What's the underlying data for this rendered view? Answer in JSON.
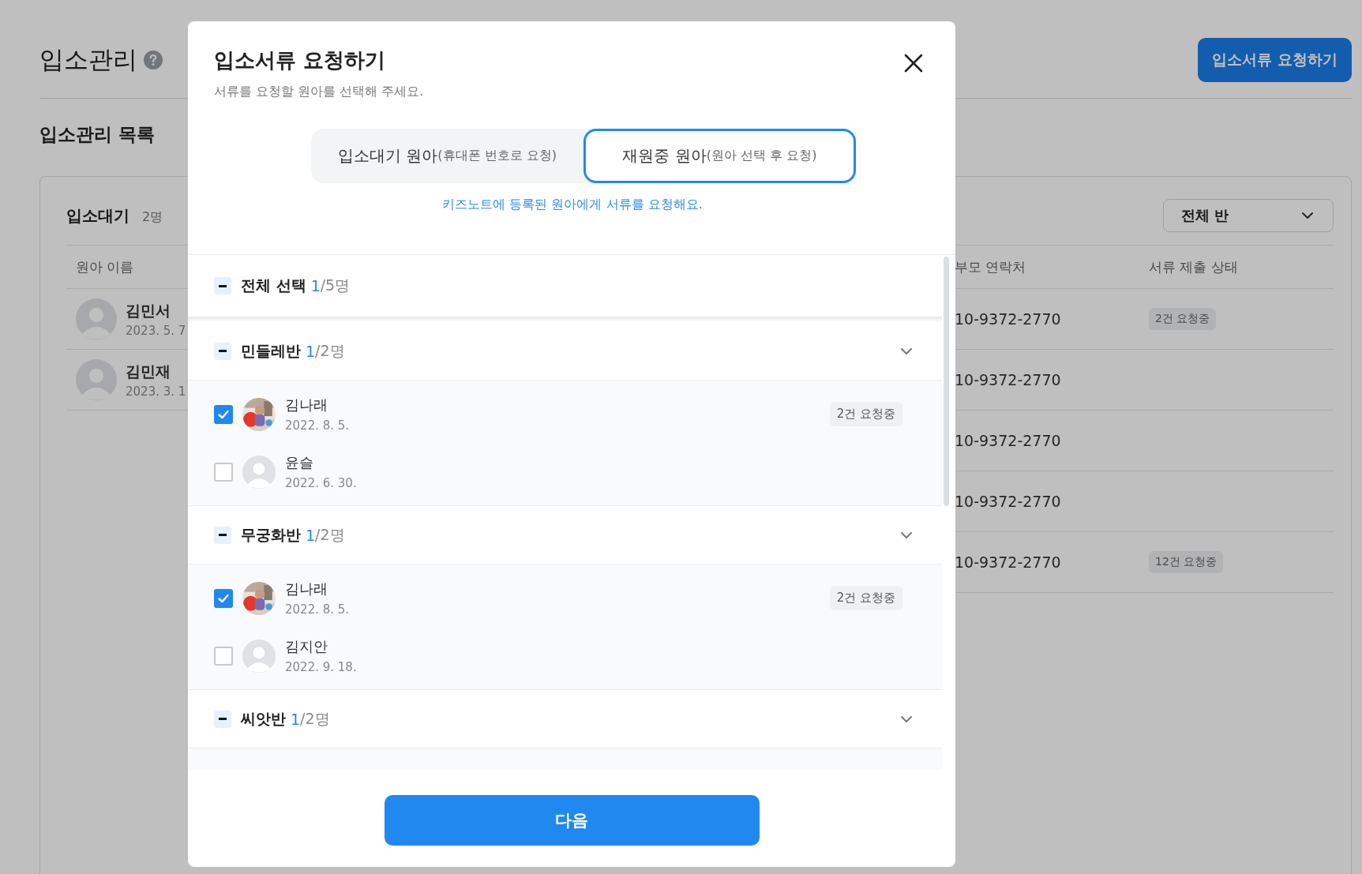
{
  "page": {
    "title": "입소관리",
    "request_button": "입소서류 요청하기",
    "list_title": "입소관리 목록",
    "card": {
      "title": "입소대기",
      "count": "2명",
      "class_filter": "전체 반",
      "columns": [
        "원아 이름",
        "부모 연락처",
        "서류 제출 상태"
      ],
      "rows_left": [
        {
          "name": "김민서",
          "date": "2023. 5. 7"
        },
        {
          "name": "김민재",
          "date": "2023. 3. 1"
        }
      ],
      "rows_right": [
        {
          "phone": "10-9372-2770",
          "status": "2건 요청중"
        },
        {
          "phone": "10-9372-2770"
        },
        {
          "phone": "10-9372-2770"
        },
        {
          "phone": "10-9372-2770"
        },
        {
          "phone": "10-9372-2770",
          "status": "12건 요청중"
        }
      ]
    }
  },
  "modal": {
    "title": "입소서류 요청하기",
    "subtitle": "서류를 요청할 원아를 선택해 주세요.",
    "tabs": [
      {
        "label": "입소대기 원아",
        "hint": "(휴대폰 번호로 요청)",
        "selected": false
      },
      {
        "label": "재원중 원아",
        "hint": "(원아 선택 후 요청)",
        "selected": true
      }
    ],
    "note": "키즈노트에 등록된 원아에게 서류를 요청해요.",
    "select_all": {
      "label": "전체 선택",
      "selected_count": "1",
      "total": "/5명",
      "indeterminate": true
    },
    "groups": [
      {
        "name": "민들레반",
        "selected_count": "1",
        "total": "/2명",
        "indeterminate": true,
        "expanded": true,
        "children": [
          {
            "name": "김나래",
            "date": "2022. 8. 5.",
            "checked": true,
            "badge": "2건 요청중"
          },
          {
            "name": "윤슬",
            "date": "2022. 6. 30.",
            "kind": "default",
            "checked": false
          }
        ]
      },
      {
        "name": "무궁화반",
        "selected_count": "1",
        "total": "/2명",
        "indeterminate": true,
        "expanded": true,
        "children": [
          {
            "name": "김나래",
            "date": "2022. 8. 5.",
            "checked": true,
            "badge": "2건 요청중"
          },
          {
            "name": "김지안",
            "date": "2022. 9. 18.",
            "kind": "default",
            "checked": false
          }
        ]
      },
      {
        "name": "씨앗반",
        "selected_count": "1",
        "total": "/2명",
        "indeterminate": true,
        "expanded": true
      }
    ],
    "next_button": "다음"
  }
}
